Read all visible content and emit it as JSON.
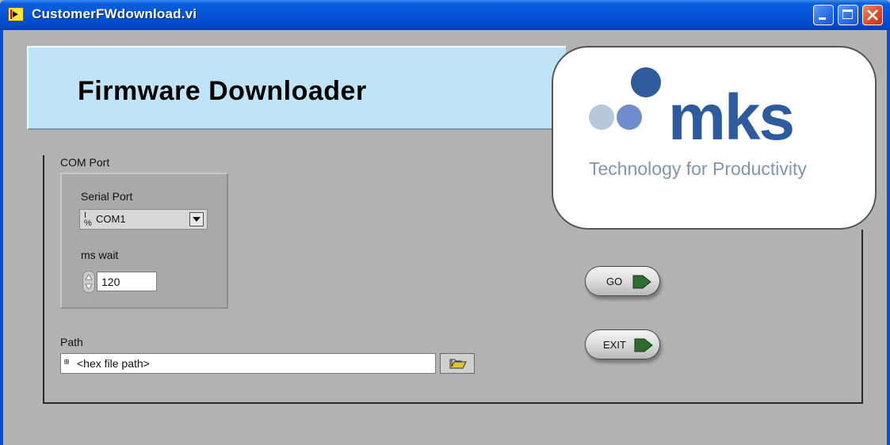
{
  "window": {
    "title": "CustomerFWdownload.vi"
  },
  "header": {
    "title": "Firmware Downloader"
  },
  "logo": {
    "wordmark": "mks",
    "tagline": "Technology for Productivity",
    "colors": {
      "primary": "#2d5b9e",
      "secondary": "#6f8ecb",
      "light": "#b8c8dc"
    }
  },
  "com_port": {
    "label": "COM Port",
    "serial_port_label": "Serial Port",
    "serial_port_value": "COM1",
    "ms_wait_label": "ms wait",
    "ms_wait_value": "120"
  },
  "path": {
    "label": "Path",
    "value": "<hex file path>"
  },
  "buttons": {
    "go": "GO",
    "exit": "EXIT"
  },
  "icons": {
    "app": "labview-vi-icon",
    "browse": "folder-open-icon",
    "arrow": "green-arrow-icon"
  },
  "colors": {
    "titlebar": "#0553d8",
    "banner": "#bfe3f7",
    "panel": "#b3b3b3",
    "arrow": "#2e7d32"
  }
}
